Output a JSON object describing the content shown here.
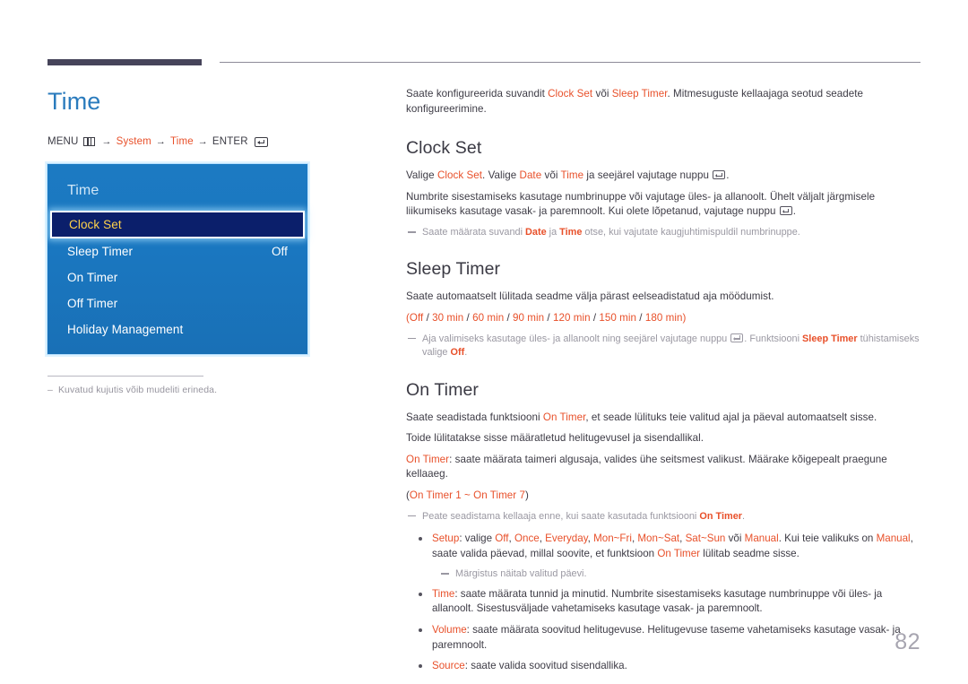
{
  "document": {
    "page_number": "82"
  },
  "left": {
    "title": "Time",
    "menu_path": {
      "menu_label": "MENU",
      "menu_icon": "menu-grid-icon",
      "arrow": "→",
      "step1": "System",
      "step2": "Time",
      "enter_label": "ENTER",
      "enter_icon": "enter-key-icon"
    },
    "osd": {
      "title": "Time",
      "items": [
        {
          "label": "Clock Set",
          "value": "",
          "selected": true
        },
        {
          "label": "Sleep Timer",
          "value": "Off",
          "selected": false
        },
        {
          "label": "On Timer",
          "value": "",
          "selected": false
        },
        {
          "label": "Off Timer",
          "value": "",
          "selected": false
        },
        {
          "label": "Holiday Management",
          "value": "",
          "selected": false
        }
      ]
    },
    "note": {
      "dash": "–",
      "text": "Kuvatud kujutis võib mudeliti erineda."
    }
  },
  "right": {
    "intro": {
      "part1": "Saate konfigureerida suvandit ",
      "kw1": "Clock Set",
      "part2": " või ",
      "kw2": "Sleep Timer",
      "part3": ". Mitmesuguste kellaajaga seotud seadete konfigureerimine."
    },
    "clock_set": {
      "heading": "Clock Set",
      "p1": {
        "part1": "Valige ",
        "kw1": "Clock Set",
        "part2": ". Valige ",
        "kw2": "Date",
        "part3": " või ",
        "kw3": "Time",
        "part4": " ja seejärel vajutage nuppu "
      },
      "p2": "Numbrite sisestamiseks kasutage numbrinuppe või vajutage üles- ja allanoolt. Ühelt väljalt järgmisele liikumiseks kasutage vasak- ja paremnoolt. Kui olete lõpetanud, vajutage nuppu ",
      "note": {
        "part1": "Saate määrata suvandi ",
        "kw1": "Date",
        "part2": " ja ",
        "kw2": "Time",
        "part3": " otse, kui vajutate kaugjuhtimispuldil numbrinuppe."
      }
    },
    "sleep_timer": {
      "heading": "Sleep Timer",
      "p1": "Saate automaatselt lülitada seadme välja pärast eelseadistatud aja möödumist.",
      "options_line": {
        "open": "(",
        "options": [
          "Off",
          "30 min",
          "60 min",
          "90 min",
          "120 min",
          "150 min",
          "180 min"
        ],
        "separator": " / ",
        "close": ")"
      },
      "note": {
        "part1": "Aja valimiseks kasutage üles- ja allanoolt ning seejärel vajutage nuppu ",
        "part2": ". Funktsiooni ",
        "kw1": "Sleep Timer",
        "part3": " tühistamiseks valige ",
        "kw2": "Off",
        "part4": "."
      }
    },
    "on_timer": {
      "heading": "On Timer",
      "p1": {
        "part1": "Saate seadistada funktsiooni ",
        "kw1": "On Timer",
        "part2": ", et seade lülituks teie valitud ajal ja päeval automaatselt sisse."
      },
      "p2": "Toide lülitatakse sisse määratletud helitugevusel ja sisendallikal.",
      "p3": {
        "kw1": "On Timer",
        "part1": ": saate määrata taimeri algusaja, valides ühe seitsmest valikust. Määrake kõigepealt praegune kellaaeg."
      },
      "p4": {
        "open": "(",
        "kw1": "On Timer 1",
        "tilde": " ~ ",
        "kw2": "On Timer 7",
        "close": ")"
      },
      "note": {
        "part1": "Peate seadistama kellaaja enne, kui saate kasutada funktsiooni ",
        "kw1": "On Timer",
        "part2": "."
      },
      "bullets": [
        {
          "kw": "Setup",
          "sep": ": ",
          "part1": "valige ",
          "options": [
            "Off",
            "Once",
            "Everyday",
            "Mon~Fri",
            "Mon~Sat",
            "Sat~Sun"
          ],
          "part2": " või ",
          "kw2": "Manual",
          "part3": ". Kui teie valikuks on ",
          "kw3": "Manual",
          "part4": ", saate valida päevad, millal soovite, et funktsioon ",
          "kw4": "On Timer",
          "part5": " lülitab seadme sisse."
        },
        {
          "kw": "Time",
          "sep": ": ",
          "part1": "saate määrata tunnid ja minutid. Numbrite sisestamiseks kasutage numbrinuppe või üles- ja allanoolt. Sisestusväljade vahetamiseks kasutage vasak- ja paremnoolt."
        },
        {
          "kw": "Volume",
          "sep": ": ",
          "part1": "saate määrata soovitud helitugevuse. Helitugevuse taseme vahetamiseks kasutage vasak- ja paremnoolt."
        },
        {
          "kw": "Source",
          "sep": ": ",
          "part1": "saate valida soovitud sisendallika."
        }
      ],
      "bullet_note": "Märgistus näitab valitud päevi."
    }
  },
  "colors": {
    "accent_blue": "#2a7bbd",
    "keyword_orange": "#e8502a",
    "osd_blue": "#1a77c0",
    "osd_selected_bg": "#0b1f6b",
    "osd_selected_text": "#ffd24a",
    "heading": "#3a3943",
    "note_gray": "#9a98a2"
  }
}
